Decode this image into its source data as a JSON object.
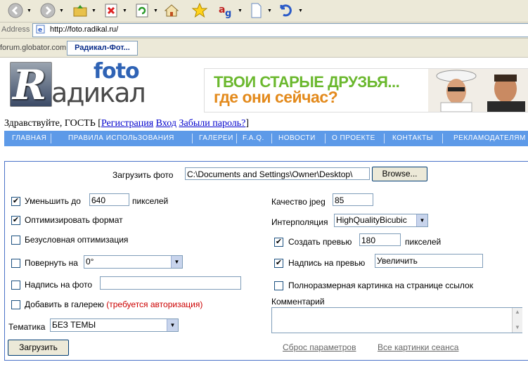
{
  "browser": {
    "address_label": "Address",
    "url": "http://foto.radikal.ru/",
    "links_label": "forum.globator.com :",
    "active_tab": "Радикал-Фот..."
  },
  "logo": {
    "foto": "foto",
    "letter": "R",
    "word": "адикал"
  },
  "banner": {
    "line1": "ТВОИ СТАРЫЕ ДРУЗЬЯ...",
    "line2": "где они сейчас?"
  },
  "greeting": {
    "text": "Здравствуйте, ГОСТЬ",
    "open": "[",
    "register": "Регистрация",
    "login": "Вход",
    "forgot": "Забыли пароль?",
    "close": "]"
  },
  "nav": [
    "ГЛАВНАЯ",
    "ПРАВИЛА ИСПОЛЬЗОВАНИЯ",
    "ГАЛЕРЕИ",
    "F.A.Q.",
    "НОВОСТИ",
    "О ПРОЕКТЕ",
    "КОНТАКТЫ",
    "РЕКЛАМОДАТЕЛЯМ"
  ],
  "form": {
    "upload_label": "Загрузить фото",
    "file_value": "C:\\Documents and Settings\\Owner\\Desktop\\",
    "browse": "Browse...",
    "reduce": {
      "label": "Уменьшить до",
      "value": "640",
      "unit": "пикселей",
      "checked": true
    },
    "optimize": {
      "label": "Оптимизировать формат",
      "checked": true
    },
    "force_opt": {
      "label": "Безусловная оптимизация",
      "checked": false
    },
    "rotate": {
      "label": "Повернуть на",
      "value": "0°",
      "checked": false
    },
    "caption": {
      "label": "Надпись на фото",
      "value": "",
      "checked": false
    },
    "gallery": {
      "label": "Добавить в галерею",
      "note": "(требуется авторизация)",
      "checked": false
    },
    "theme": {
      "label": "Тематика",
      "value": "БЕЗ ТЕМЫ"
    },
    "quality": {
      "label": "Качество jpeg",
      "value": "85"
    },
    "interp": {
      "label": "Интерполяция",
      "value": "HighQualityBicubic"
    },
    "preview": {
      "label": "Создать превью",
      "value": "180",
      "unit": "пикселей",
      "checked": true
    },
    "preview_caption": {
      "label": "Надпись на превью",
      "value": "Увеличить",
      "checked": true
    },
    "fullsize": {
      "label": "Полноразмерная картинка на странице ссылок",
      "checked": false
    },
    "comment": {
      "label": "Комментарий",
      "value": ""
    },
    "submit": "Загрузить",
    "reset": "Сброс параметров",
    "all_images": "Все картинки сеанса"
  },
  "colors": {
    "nav_bg": "#5d9ae8",
    "form_border": "#4a72c8",
    "link": "#0000cc"
  }
}
